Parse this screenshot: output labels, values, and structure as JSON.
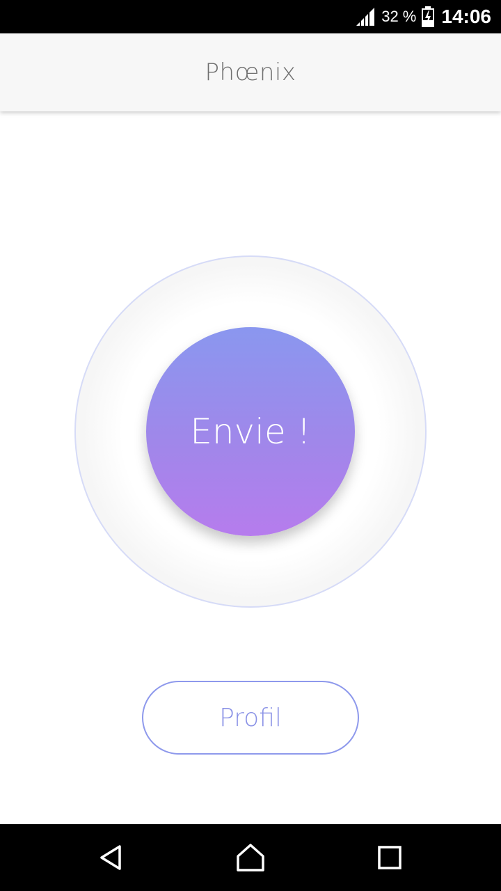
{
  "status_bar": {
    "battery_percent": "32 %",
    "time": "14:06",
    "icons": [
      "signal-icon",
      "battery-charging-icon"
    ]
  },
  "app_bar": {
    "title": "Phœnix"
  },
  "main": {
    "envie_button_label": "Envie !",
    "profil_button_label": "Profil"
  },
  "nav_bar": {
    "icons": [
      "back-icon",
      "home-icon",
      "recents-icon"
    ]
  },
  "colors": {
    "accent": "#8e99ec",
    "gradient_top": "#8a97ef",
    "gradient_bottom": "#b67ced",
    "ring_border": "#d6dbf7"
  }
}
